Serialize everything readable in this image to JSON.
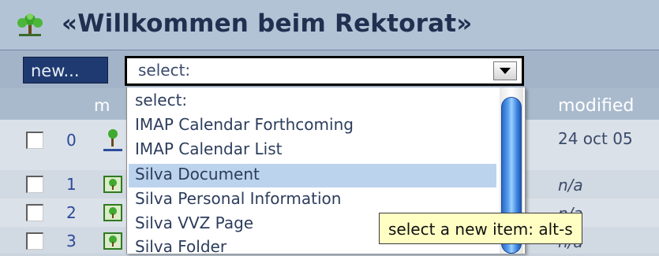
{
  "header": {
    "title": "«Willkommen beim Rektorat»",
    "icon": "publication-tree-icon"
  },
  "toolbar": {
    "new_label": "new...",
    "select": {
      "value": "select:"
    }
  },
  "table": {
    "headers": {
      "name_partial": "m",
      "modified": "modified"
    },
    "rows": [
      {
        "num": "0",
        "icon": "tree-icon",
        "modified": "24 oct 05"
      },
      {
        "num": "1",
        "icon": "folder-tree-icon",
        "modified": "n/a"
      },
      {
        "num": "2",
        "icon": "folder-tree-icon",
        "modified": "n/a"
      },
      {
        "num": "3",
        "icon": "folder-tree-icon",
        "modified": "n/a"
      }
    ]
  },
  "dropdown": {
    "options": [
      "select:",
      "IMAP Calendar Forthcoming",
      "IMAP Calendar List",
      "Silva Document",
      "Silva Personal Information",
      "Silva VVZ Page",
      "Silva Folder"
    ],
    "highlighted_index": 3
  },
  "tooltip": {
    "text": "select a new item: alt-s"
  },
  "colors": {
    "accent": "#1e3a70",
    "highlight": "#bcd3ee",
    "tooltip_bg": "#ffffc4"
  }
}
